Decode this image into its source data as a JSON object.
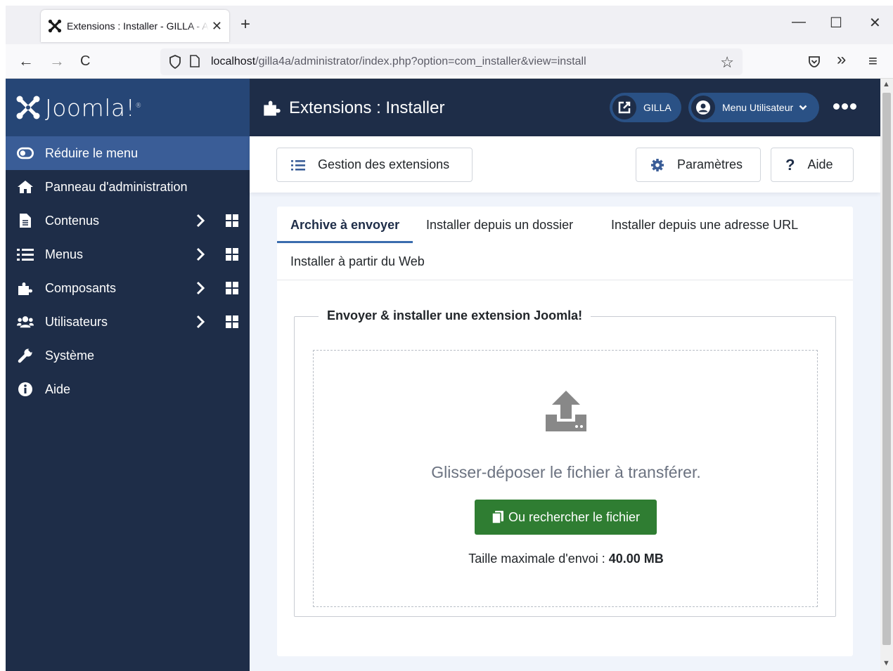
{
  "browser": {
    "tab_title": "Extensions : Installer - GILLA - Administration",
    "tab_close": "✕",
    "new_tab": "+",
    "url_host": "localhost",
    "url_path": "/gilla4a/administrator/index.php?option=com_installer&view=install",
    "window_controls": {
      "minimize": "—",
      "maximize": "☐",
      "close": "✕"
    },
    "nav": {
      "back": "←",
      "forward": "→",
      "reload": "C",
      "bookmark": "☆",
      "pocket": "pocket-icon",
      "extensions": "»",
      "menu": "≡"
    }
  },
  "brand": {
    "logo_text": "Joomla!",
    "registered": "®"
  },
  "sidebar": {
    "items": [
      {
        "label": "Réduire le menu",
        "icon": "toggle-icon",
        "active": true
      },
      {
        "label": "Panneau d'administration",
        "icon": "home-icon"
      },
      {
        "label": "Contenus",
        "icon": "file-icon",
        "has_children": true
      },
      {
        "label": "Menus",
        "icon": "list-icon",
        "has_children": true
      },
      {
        "label": "Composants",
        "icon": "puzzle-icon",
        "has_children": true
      },
      {
        "label": "Utilisateurs",
        "icon": "users-icon",
        "has_children": true
      },
      {
        "label": "Système",
        "icon": "wrench-icon"
      },
      {
        "label": "Aide",
        "icon": "info-icon"
      }
    ]
  },
  "header": {
    "title": "Extensions : Installer",
    "site_label": "GILLA",
    "user_menu_label": "Menu Utilisateur"
  },
  "toolbar": {
    "manage_label": "Gestion des extensions",
    "options_label": "Paramètres",
    "help_label": "Aide",
    "help_glyph": "?"
  },
  "tabs": [
    {
      "label": "Archive à envoyer",
      "active": true
    },
    {
      "label": "Installer depuis un dossier"
    },
    {
      "label": "Installer depuis une adresse URL"
    },
    {
      "label": "Installer à partir du Web"
    }
  ],
  "upload": {
    "legend": "Envoyer & installer une extension Joomla!",
    "drop_text": "Glisser-déposer le fichier à transférer.",
    "browse_label": "Ou rechercher le fichier",
    "max_size_label": "Taille maximale d'envoi : ",
    "max_size_value": "40.00 MB"
  },
  "colors": {
    "sidebar_bg": "#1e2d48",
    "brand_bg": "#264676",
    "active_item_bg": "#3a5d97",
    "pill_bg": "#2a5185",
    "browse_button": "#2f7d32",
    "tab_underline": "#3a6cae"
  }
}
